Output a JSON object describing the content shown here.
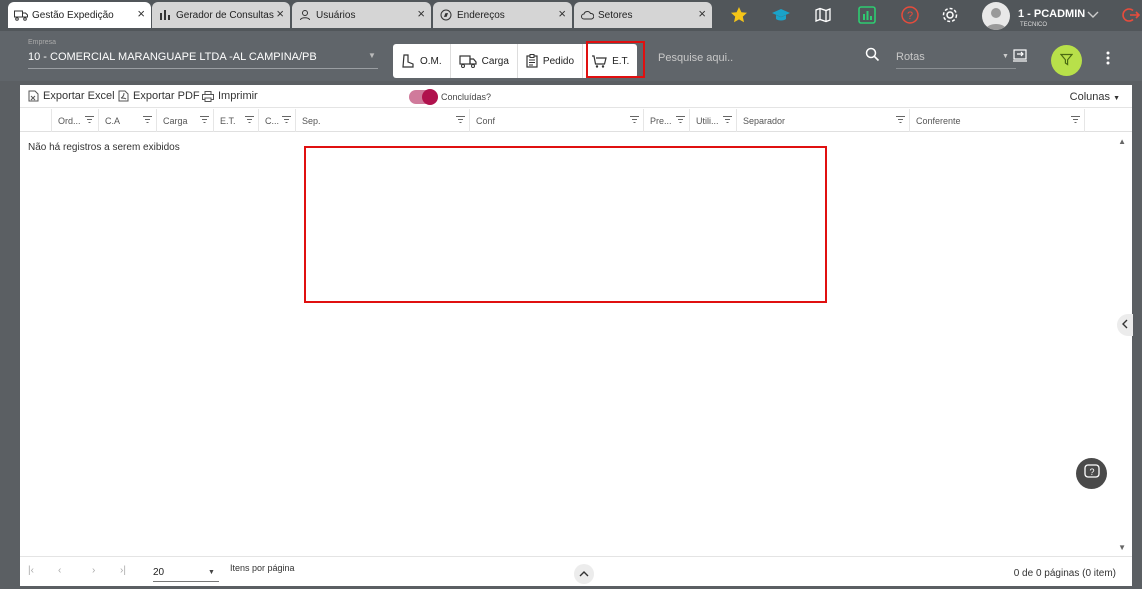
{
  "tabs": [
    {
      "label": "Gestão Expedição",
      "icon": "truck-icon",
      "active": true
    },
    {
      "label": "Gerador de Consultas",
      "icon": "chart-icon",
      "active": false
    },
    {
      "label": "Usuários",
      "icon": "user-icon",
      "active": false
    },
    {
      "label": "Endereços",
      "icon": "compass-icon",
      "active": false
    },
    {
      "label": "Setores",
      "icon": "cloud-icon",
      "active": false
    }
  ],
  "tab_close": "×",
  "user": {
    "name": "1 - PCADMIN",
    "role": "TECNICO"
  },
  "header": {
    "empresa_label": "Empresa",
    "empresa_value": "10 - COMERCIAL MARANGUAPE LTDA -AL CAMPINA/PB",
    "segments": [
      "O.M.",
      "Carga",
      "Pedido",
      "E.T."
    ],
    "search_placeholder": "Pesquise aqui..",
    "rotas_label": "Rotas"
  },
  "toolbar": {
    "export_excel": "Exportar Excel",
    "export_pdf": "Exportar PDF",
    "print": "Imprimir",
    "toggle_label": "Concluídas?",
    "colunas": "Colunas"
  },
  "columns": [
    "Ord...",
    "C.A",
    "Carga",
    "E.T.",
    "C...",
    "Sep.",
    "Conf",
    "Pre...",
    "Utili...",
    "Separador",
    "Conferente"
  ],
  "grid": {
    "empty_message": "Não há registros a serem exibidos"
  },
  "pager": {
    "page_size": "20",
    "items_label": "Itens por página",
    "info": "0 de 0 páginas (0 item)"
  },
  "colors": {
    "accent": "#b0124d",
    "filter_button": "#b8e04a",
    "highlight": "#e01010"
  }
}
